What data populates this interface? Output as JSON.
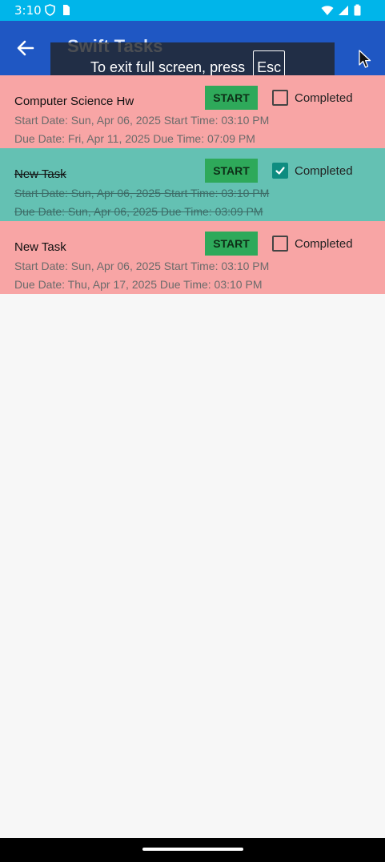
{
  "status_bar": {
    "time": "3:10",
    "left_icons": [
      "shield-icon",
      "sim-card-icon"
    ],
    "right_icons": [
      "wifi-icon",
      "signal-icon",
      "battery-icon"
    ]
  },
  "app_bar": {
    "back_icon": "arrow-left-icon",
    "title": "Swift Tasks"
  },
  "fullscreen_toast": {
    "message": "To exit full screen, press",
    "key": "Esc"
  },
  "tasks": [
    {
      "title": "Computer Science Hw",
      "start_label": "START",
      "completed_label": "Completed",
      "completed": false,
      "start_info": "Start Date: Sun, Apr 06, 2025 Start Time: 03:10 PM",
      "due_info": "Due Date: Fri, Apr 11, 2025 Due Time: 07:09 PM"
    },
    {
      "title": "New Task",
      "start_label": "START",
      "completed_label": "Completed",
      "completed": true,
      "start_info": "Start Date: Sun, Apr 06, 2025 Start Time: 03:10 PM",
      "due_info": "Due Date: Sun, Apr 06, 2025 Due Time: 03:09 PM"
    },
    {
      "title": "New Task",
      "start_label": "START",
      "completed_label": "Completed",
      "completed": false,
      "start_info": "Start Date: Sun, Apr 06, 2025 Start Time: 03:10 PM",
      "due_info": "Due Date: Thu, Apr 17, 2025 Due Time: 03:10 PM"
    }
  ],
  "colors": {
    "status_bar": "#00b5ea",
    "app_bar": "#1f57c3",
    "pending_row": "#f8a5a5",
    "done_row": "#64c1b3",
    "start_button": "#2ea95a",
    "checkbox_checked": "#0e8c80"
  }
}
